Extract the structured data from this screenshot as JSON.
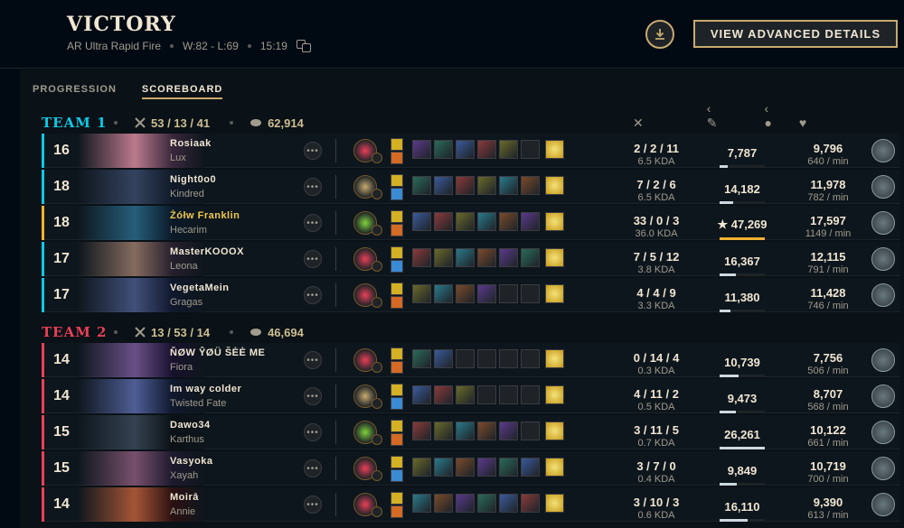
{
  "header": {
    "title": "VICTORY",
    "mode": "AR Ultra Rapid Fire",
    "record": "W:82 - L:69",
    "duration": "15:19",
    "advanced_label": "VIEW ADVANCED DETAILS"
  },
  "tabs": [
    "PROGRESSION",
    "SCOREBOARD"
  ],
  "colors": {
    "gold": "#c8aa6e",
    "team1": "#0acbe6",
    "team2": "#e84057",
    "highlight": "#f0b232"
  },
  "teams": [
    {
      "name": "TEAM 1",
      "kda": "53 / 13 / 41",
      "gold": "62,914",
      "players": [
        {
          "level": "16",
          "name": "Rosiaak",
          "champ": "Lux",
          "kda": "2 / 2 / 11",
          "ratio": "6.5 KDA",
          "damage": "7,787",
          "dmg_frac": 0.17,
          "gold": "9,796",
          "gpm": "640 / min",
          "items": 6
        },
        {
          "level": "18",
          "name": "Night0o0",
          "champ": "Kindred",
          "kda": "7 / 2 / 6",
          "ratio": "6.5 KDA",
          "damage": "14,182",
          "dmg_frac": 0.3,
          "gold": "11,978",
          "gpm": "782 / min",
          "items": 7
        },
        {
          "level": "18",
          "name": "Żółw Franklin",
          "champ": "Hecarim",
          "kda": "33 / 0 / 3",
          "ratio": "36.0 KDA",
          "damage": "★ 47,269",
          "dmg_frac": 1.0,
          "gold": "17,597",
          "gpm": "1149 / min",
          "items": 7,
          "me": true
        },
        {
          "level": "17",
          "name": "MasterKOOOX",
          "champ": "Leona",
          "kda": "7 / 5 / 12",
          "ratio": "3.8 KDA",
          "damage": "16,367",
          "dmg_frac": 0.35,
          "gold": "12,115",
          "gpm": "791 / min",
          "items": 7
        },
        {
          "level": "17",
          "name": "VegetaMein",
          "champ": "Gragas",
          "kda": "4 / 4 / 9",
          "ratio": "3.3 KDA",
          "damage": "11,380",
          "dmg_frac": 0.24,
          "gold": "11,428",
          "gpm": "746 / min",
          "items": 5
        }
      ]
    },
    {
      "name": "TEAM 2",
      "kda": "13 / 53 / 14",
      "gold": "46,694",
      "players": [
        {
          "level": "14",
          "name": "ŇØW ŶØÜ ŠĖĖ ME",
          "champ": "Fiora",
          "kda": "0 / 14 / 4",
          "ratio": "0.3 KDA",
          "damage": "10,739",
          "dmg_frac": 0.41,
          "gold": "7,756",
          "gpm": "506 / min",
          "items": 3
        },
        {
          "level": "14",
          "name": "Im way colder",
          "champ": "Twisted Fate",
          "kda": "4 / 11 / 2",
          "ratio": "0.5 KDA",
          "damage": "9,473",
          "dmg_frac": 0.36,
          "gold": "8,707",
          "gpm": "568 / min",
          "items": 4
        },
        {
          "level": "15",
          "name": "Dawo34",
          "champ": "Karthus",
          "kda": "3 / 11 / 5",
          "ratio": "0.7 KDA",
          "damage": "26,261",
          "dmg_frac": 1.0,
          "gold": "10,122",
          "gpm": "661 / min",
          "items": 6
        },
        {
          "level": "15",
          "name": "Vasyoka",
          "champ": "Xayah",
          "kda": "3 / 7 / 0",
          "ratio": "0.4 KDA",
          "damage": "9,849",
          "dmg_frac": 0.38,
          "gold": "10,719",
          "gpm": "700 / min",
          "items": 7
        },
        {
          "level": "14",
          "name": "Moirā",
          "champ": "Annie",
          "kda": "3 / 10 / 3",
          "ratio": "0.6 KDA",
          "damage": "16,110",
          "dmg_frac": 0.61,
          "gold": "9,390",
          "gpm": "613 / min",
          "items": 7
        }
      ]
    }
  ]
}
